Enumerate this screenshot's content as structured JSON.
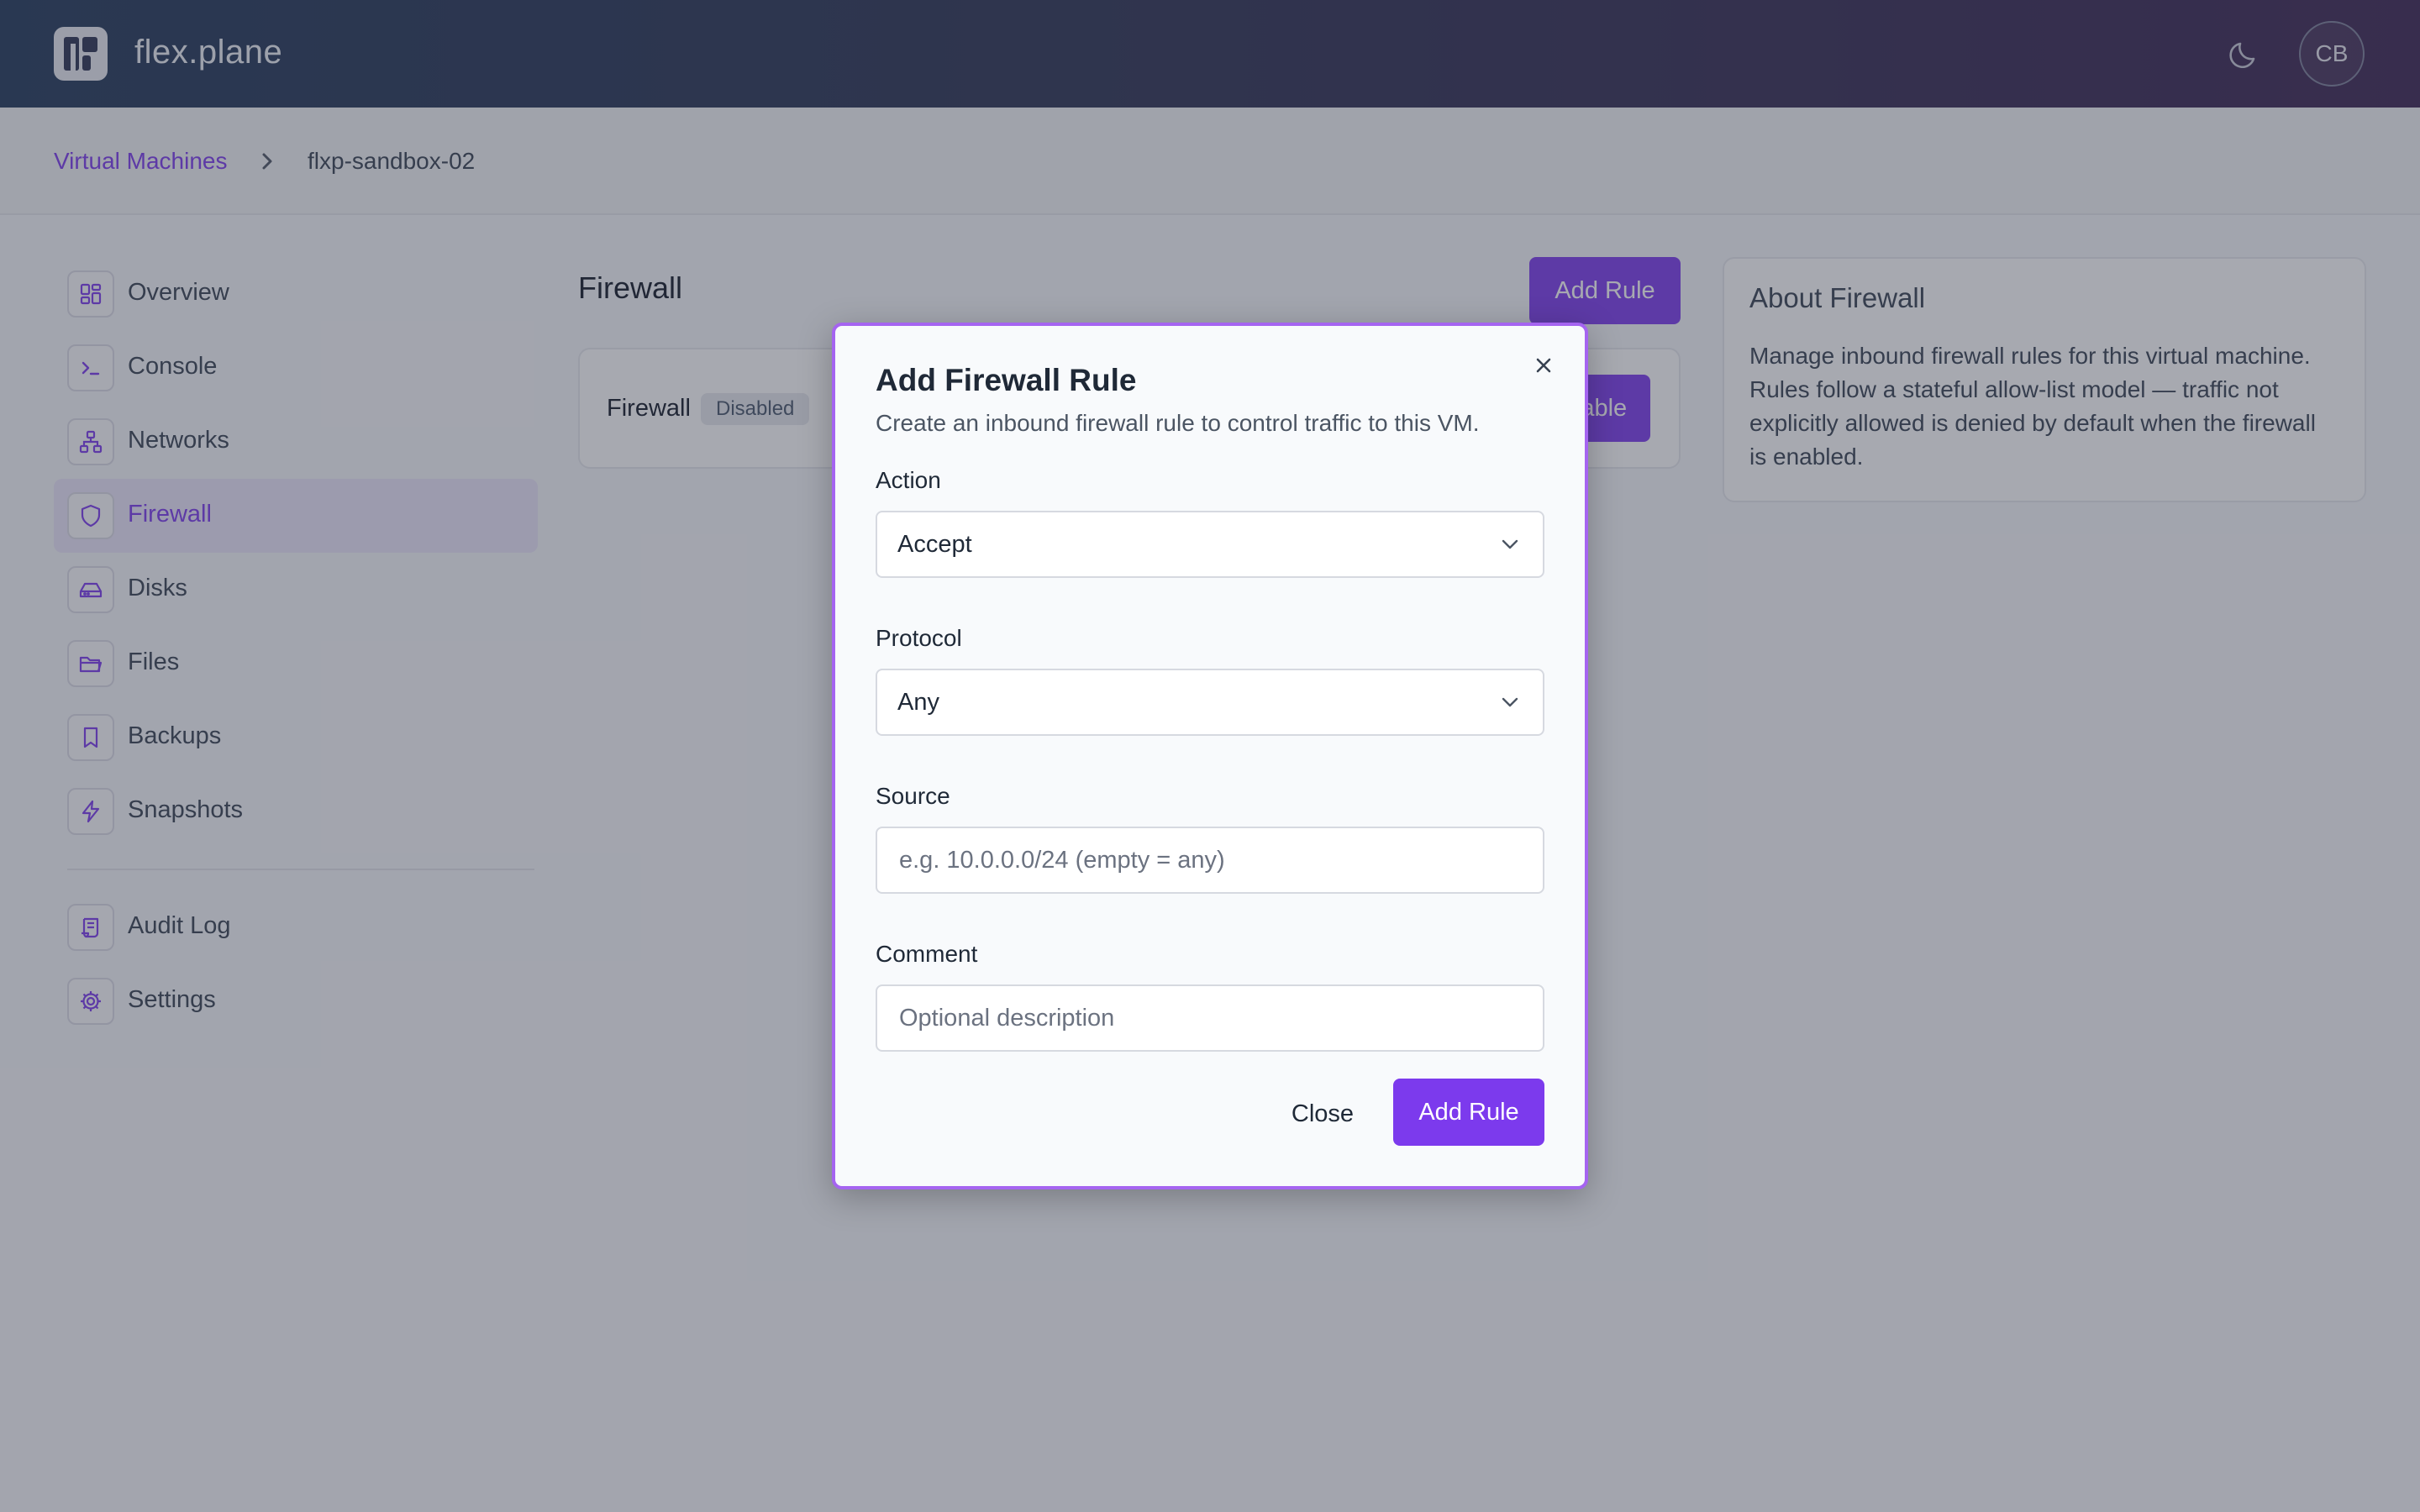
{
  "header": {
    "brand": "flex.plane",
    "avatar_initials": "CB"
  },
  "breadcrumb": {
    "parent": "Virtual Machines",
    "current": "flxp-sandbox-02"
  },
  "sidebar": {
    "items": [
      {
        "label": "Overview",
        "icon": "overview-grid-icon"
      },
      {
        "label": "Console",
        "icon": "terminal-icon"
      },
      {
        "label": "Networks",
        "icon": "network-icon"
      },
      {
        "label": "Firewall",
        "icon": "shield-icon",
        "active": true
      },
      {
        "label": "Disks",
        "icon": "hard-drive-icon"
      },
      {
        "label": "Files",
        "icon": "folder-icon"
      },
      {
        "label": "Backups",
        "icon": "bookmark-icon"
      },
      {
        "label": "Snapshots",
        "icon": "lightning-icon"
      }
    ],
    "secondary": [
      {
        "label": "Audit Log",
        "icon": "scroll-icon"
      },
      {
        "label": "Settings",
        "icon": "gear-icon"
      }
    ]
  },
  "main": {
    "title": "Firewall",
    "add_rule_label": "Add Rule",
    "card": {
      "label": "Firewall",
      "status_badge": "Disabled",
      "enable_label": "Enable"
    }
  },
  "about": {
    "title": "About Firewall",
    "text": "Manage inbound firewall rules for this virtual machine. Rules follow a stateful allow-list model — traffic not explicitly allowed is denied by default when the firewall is enabled."
  },
  "modal": {
    "title": "Add Firewall Rule",
    "subtitle": "Create an inbound firewall rule to control traffic to this VM.",
    "action": {
      "label": "Action",
      "value": "Accept"
    },
    "protocol": {
      "label": "Protocol",
      "value": "Any"
    },
    "source": {
      "label": "Source",
      "placeholder": "e.g. 10.0.0.0/24 (empty = any)"
    },
    "comment": {
      "label": "Comment",
      "placeholder": "Optional description"
    },
    "close_label": "Close",
    "submit_label": "Add Rule"
  },
  "colors": {
    "accent": "#7c3aed",
    "modal_border": "#a564f0",
    "header_start": "#1f3658",
    "header_end": "#3a2350"
  }
}
